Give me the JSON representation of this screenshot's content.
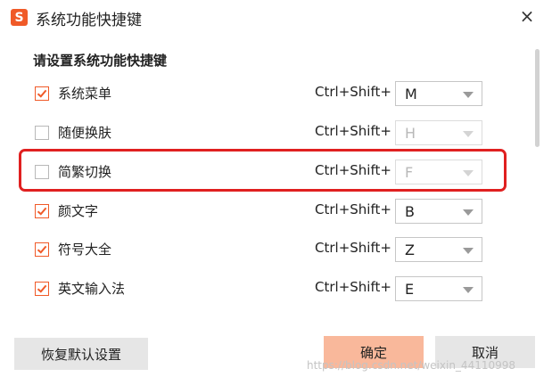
{
  "window": {
    "title": "系统功能快捷键",
    "logo": "S",
    "close_glyph": "×"
  },
  "heading": "请设置系统功能快捷键",
  "items": [
    {
      "label": "系统菜单",
      "checked": true,
      "prefix": "Ctrl+Shift+",
      "key": "M",
      "enabled": true
    },
    {
      "label": "随便换肤",
      "checked": false,
      "prefix": "Ctrl+Shift+",
      "key": "H",
      "enabled": false
    },
    {
      "label": "简繁切换",
      "checked": false,
      "prefix": "Ctrl+Shift+",
      "key": "F",
      "enabled": false
    },
    {
      "label": "颜文字",
      "checked": true,
      "prefix": "Ctrl+Shift+",
      "key": "B",
      "enabled": true
    },
    {
      "label": "符号大全",
      "checked": true,
      "prefix": "Ctrl+Shift+",
      "key": "Z",
      "enabled": true
    },
    {
      "label": "英文输入法",
      "checked": true,
      "prefix": "Ctrl+Shift+",
      "key": "E",
      "enabled": true
    }
  ],
  "buttons": {
    "reset": "恢复默认设置",
    "ok": "确定",
    "cancel": "取消"
  },
  "watermark": "https://blog.csdn.net/weixin_44110998",
  "colors": {
    "accent": "#f05a28",
    "highlight": "#e02020",
    "ok_button": "#f9b89b"
  }
}
